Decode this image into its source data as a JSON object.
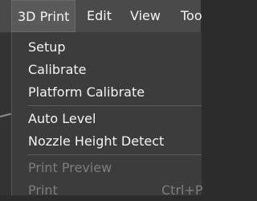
{
  "menubar": {
    "items": [
      {
        "label": "3D Print"
      },
      {
        "label": "Edit"
      },
      {
        "label": "View"
      },
      {
        "label": "Too"
      }
    ]
  },
  "dropdown": {
    "items": [
      {
        "label": "Setup"
      },
      {
        "label": "Calibrate"
      },
      {
        "label": "Platform Calibrate"
      },
      {
        "label": "Auto Level"
      },
      {
        "label": "Nozzle Height Detect"
      },
      {
        "label": "Print Preview"
      },
      {
        "label": "Print",
        "shortcut": "Ctrl+P"
      }
    ]
  }
}
